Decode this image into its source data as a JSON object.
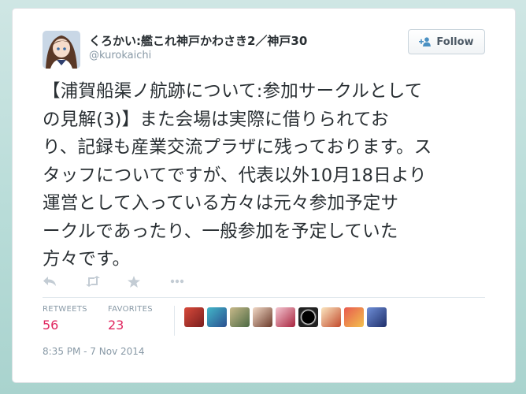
{
  "author": {
    "display_name": "くろかい:艦これ神戸かわさき2／神戸30",
    "screen_name": "@kurokaichi"
  },
  "follow_button": {
    "label": "Follow",
    "icon": "add-user-icon"
  },
  "tweet": {
    "lines": [
      "【浦賀船渠ノ航跡について:参加サークルとして",
      "の見解(3)】また会場は実際に借りられてお",
      "り、記録も産業交流プラザに残っております。ス",
      "タッフについてですが、代表以外10月18日より",
      "運営として入っている方々は元々参加予定サ",
      "ークルであったり、一般参加を予定していた",
      "方々です。"
    ]
  },
  "actions": [
    "reply-icon",
    "retweet-icon",
    "favorite-icon",
    "more-icon"
  ],
  "stats": {
    "retweets": {
      "label": "RETWEETS",
      "count": "56"
    },
    "favorites": {
      "label": "FAVORITES",
      "count": "23"
    }
  },
  "favoriters_avatars": 9,
  "timestamp": "8:35 PM - 7 Nov 2014",
  "colors": {
    "accent_count": "#e0245e",
    "muted": "#8899a6",
    "text": "#292f33"
  }
}
